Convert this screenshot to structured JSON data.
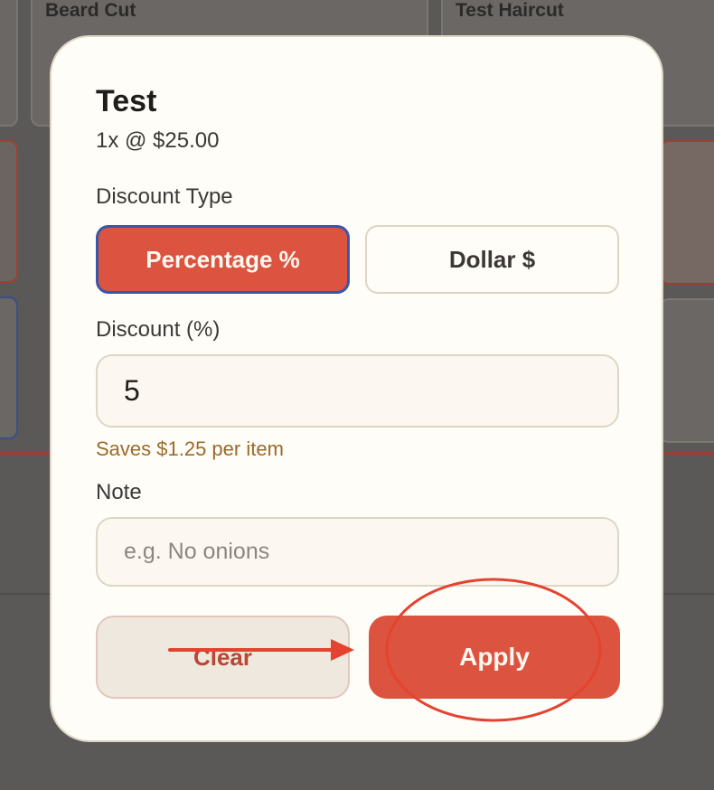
{
  "background": {
    "card_titles": [
      "Beard Cut",
      "Test Haircut"
    ]
  },
  "modal": {
    "title": "Test",
    "subtitle": "1x @ $25.00",
    "discount_type_label": "Discount Type",
    "options": [
      "Percentage %",
      "Dollar $"
    ],
    "selected_option": "Percentage %",
    "discount_label": "Discount (%)",
    "discount_value": "5",
    "savings_hint": "Saves $1.25 per item",
    "note_label": "Note",
    "note_placeholder": "e.g. No onions",
    "note_value": "",
    "clear_label": "Clear",
    "apply_label": "Apply"
  },
  "colors": {
    "accent": "#dc5440",
    "selected_border": "#3c55a6",
    "hint_text": "#9b6a2a",
    "annotation": "#e3432f"
  },
  "icons": {
    "annotation_arrow": "arrow-right-icon",
    "annotation_circle": "highlight-circle-icon"
  }
}
